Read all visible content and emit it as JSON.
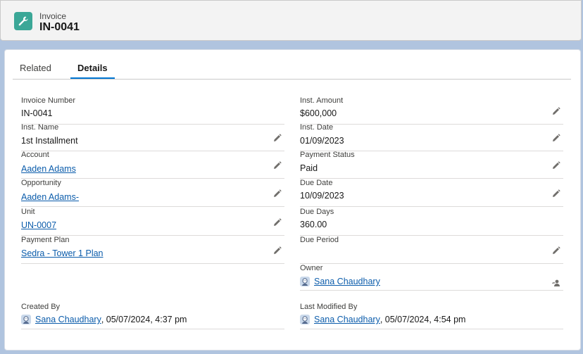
{
  "header": {
    "object_type": "Invoice",
    "record_name": "IN-0041",
    "icon": "wrench-icon",
    "icon_color": "#3ba797"
  },
  "tabs": [
    {
      "label": "Related",
      "active": false
    },
    {
      "label": "Details",
      "active": true
    }
  ],
  "left_fields": [
    {
      "label": "Invoice Number",
      "value": "IN-0041",
      "link": false,
      "editable": false
    },
    {
      "label": "Inst. Name",
      "value": "1st Installment",
      "link": false,
      "editable": true
    },
    {
      "label": "Account",
      "value": "Aaden Adams",
      "link": true,
      "editable": true
    },
    {
      "label": "Opportunity",
      "value": "Aaden Adams-",
      "link": true,
      "editable": true
    },
    {
      "label": "Unit",
      "value": "UN-0007",
      "link": true,
      "editable": true
    },
    {
      "label": "Payment Plan",
      "value": "Sedra - Tower 1 Plan",
      "link": true,
      "editable": true
    }
  ],
  "right_fields": [
    {
      "label": "Inst. Amount",
      "value": "$600,000",
      "link": false,
      "editable": true
    },
    {
      "label": "Inst. Date",
      "value": "01/09/2023",
      "link": false,
      "editable": true
    },
    {
      "label": "Payment Status",
      "value": "Paid",
      "link": false,
      "editable": true
    },
    {
      "label": "Due Date",
      "value": "10/09/2023",
      "link": false,
      "editable": true
    },
    {
      "label": "Due Days",
      "value": "360.00",
      "link": false,
      "editable": false
    },
    {
      "label": "Due Period",
      "value": "",
      "link": false,
      "editable": true
    }
  ],
  "owner": {
    "label": "Owner",
    "name": "Sana Chaudhary",
    "icon": "change-owner-icon"
  },
  "created_by": {
    "label": "Created By",
    "name": "Sana Chaudhary",
    "date": ", 05/07/2024, 4:37 pm"
  },
  "last_modified_by": {
    "label": "Last Modified By",
    "name": "Sana Chaudhary",
    "date": ", 05/07/2024, 4:54 pm"
  },
  "colors": {
    "link": "#0b5cab",
    "tab_active": "#0176d3",
    "page_bg": "#b0c4df"
  }
}
